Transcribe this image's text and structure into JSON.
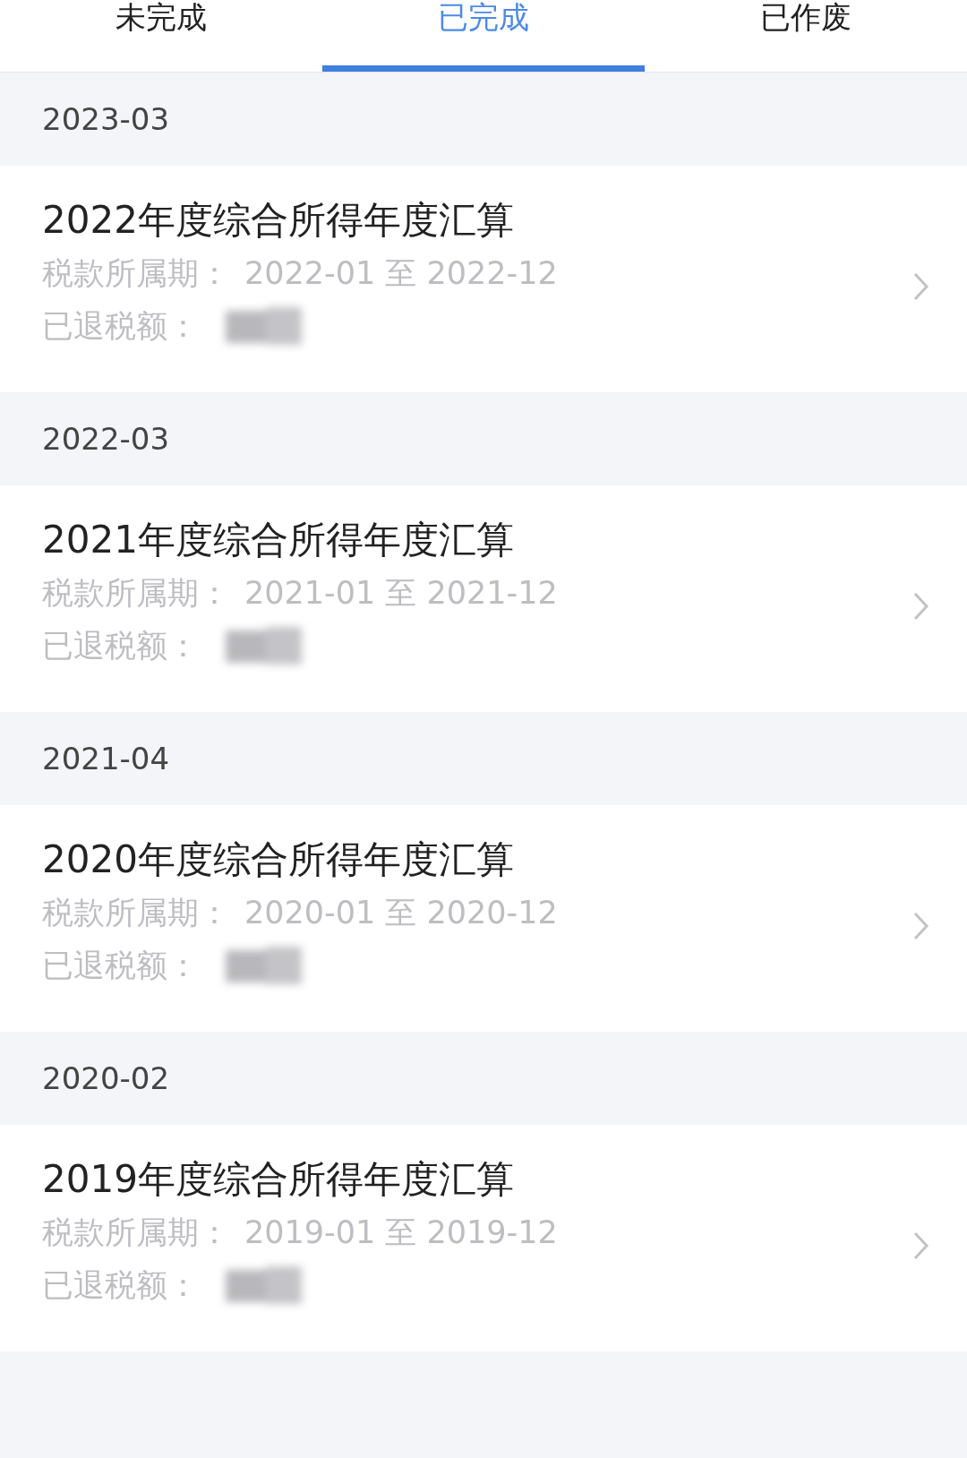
{
  "tabs": [
    {
      "label": "未完成",
      "selected": false
    },
    {
      "label": "已完成",
      "selected": true
    },
    {
      "label": "已作废",
      "selected": false
    }
  ],
  "groups": [
    {
      "month": "2023-03",
      "records": [
        {
          "title": "2022年度综合所得年度汇算",
          "period_label": "税款所属期：",
          "period": "2022-01 至 2022-12",
          "refund_label": "已退税额："
        }
      ]
    },
    {
      "month": "2022-03",
      "records": [
        {
          "title": "2021年度综合所得年度汇算",
          "period_label": "税款所属期：",
          "period": "2021-01 至 2021-12",
          "refund_label": "已退税额："
        }
      ]
    },
    {
      "month": "2021-04",
      "records": [
        {
          "title": "2020年度综合所得年度汇算",
          "period_label": "税款所属期：",
          "period": "2020-01 至 2020-12",
          "refund_label": "已退税额："
        }
      ]
    },
    {
      "month": "2020-02",
      "records": [
        {
          "title": "2019年度综合所得年度汇算",
          "period_label": "税款所属期：",
          "period": "2019-01 至 2019-12",
          "refund_label": "已退税额："
        }
      ]
    }
  ]
}
